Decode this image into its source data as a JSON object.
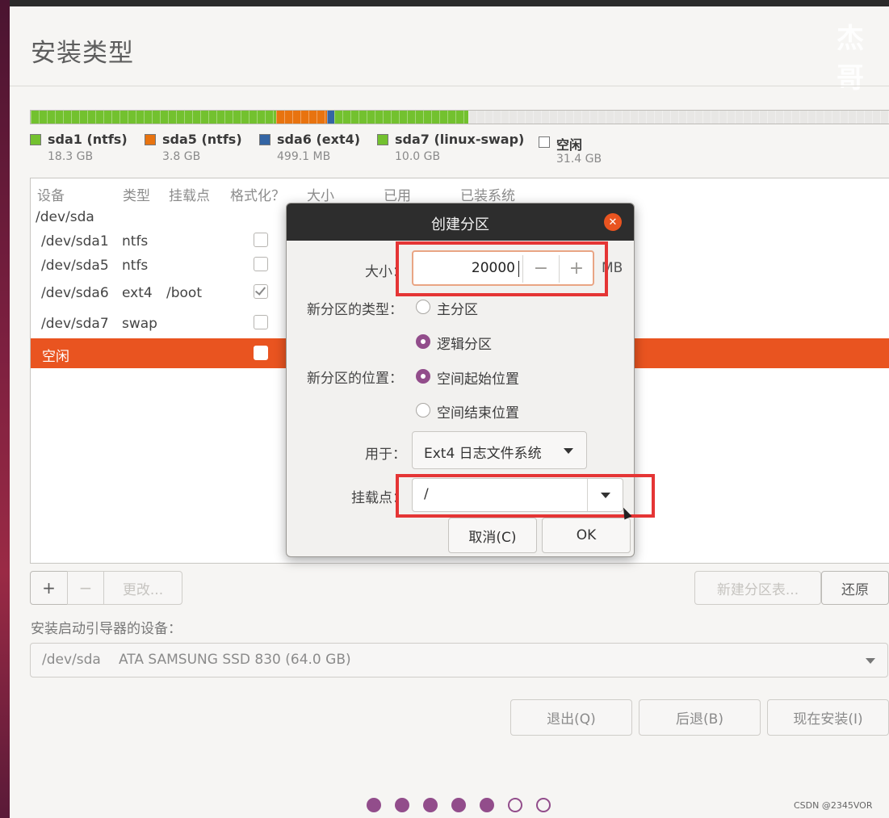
{
  "page": {
    "title": "安装类型",
    "watermark": "杰哥"
  },
  "partition_bar": {
    "segments": [
      {
        "name": "sda1 (ntfs)",
        "size": "18.3 GB",
        "color": "#73c12f",
        "fraction": 0.286
      },
      {
        "name": "sda5 (ntfs)",
        "size": "3.8 GB",
        "color": "#e8730f",
        "fraction": 0.059
      },
      {
        "name": "sda6 (ext4)",
        "size": "499.1 MB",
        "color": "#3465a4",
        "fraction": 0.008
      },
      {
        "name": "sda7 (linux-swap)",
        "size": "10.0 GB",
        "color": "#73c12f",
        "fraction": 0.156
      },
      {
        "name": "空闲",
        "size": "31.4 GB",
        "color": "#e8e7e5",
        "fraction": 0.491
      }
    ]
  },
  "table": {
    "headers": [
      "设备",
      "类型",
      "挂载点",
      "格式化？",
      "大小",
      "已用",
      "已装系统"
    ],
    "disk": "/dev/sda",
    "rows": [
      {
        "device": "/dev/sda1",
        "type": "ntfs",
        "mount": "",
        "format": false
      },
      {
        "device": "/dev/sda5",
        "type": "ntfs",
        "mount": "",
        "format": false
      },
      {
        "device": "/dev/sda6",
        "type": "ext4",
        "mount": "/boot",
        "format": true
      },
      {
        "device": "/dev/sda7",
        "type": "swap",
        "mount": "",
        "format": false
      }
    ],
    "selected_row": {
      "device": "空闲",
      "format": false
    }
  },
  "table_buttons": {
    "add": "+",
    "remove": "−",
    "change": "更改...",
    "new_table": "新建分区表...",
    "revert": "还原"
  },
  "bootloader": {
    "label": "安装启动引导器的设备：",
    "device": "/dev/sda",
    "description": "ATA SAMSUNG SSD 830 (64.0 GB)"
  },
  "nav_buttons": {
    "quit": "退出(Q)",
    "back": "后退(B)",
    "install": "现在安装(I)"
  },
  "steps": {
    "total": 7,
    "completed": 5
  },
  "credit": "CSDN @2345VOR",
  "dialog": {
    "title": "创建分区",
    "size_label": "大小：",
    "size_value": "20000",
    "size_unit": "MB",
    "minus": "−",
    "plus": "+",
    "type_label": "新分区的类型：",
    "type_options": [
      "主分区",
      "逻辑分区"
    ],
    "type_selected": 1,
    "location_label": "新分区的位置：",
    "location_options": [
      "空间起始位置",
      "空间结束位置"
    ],
    "location_selected": 0,
    "use_label": "用于：",
    "use_value": "Ext4 日志文件系统",
    "mount_label": "挂载点：",
    "mount_value": "/",
    "cancel": "取消(C)",
    "ok": "OK"
  },
  "colors": {
    "accent": "#e95420",
    "aubergine": "#924d8b",
    "annotation": "#e53535"
  }
}
